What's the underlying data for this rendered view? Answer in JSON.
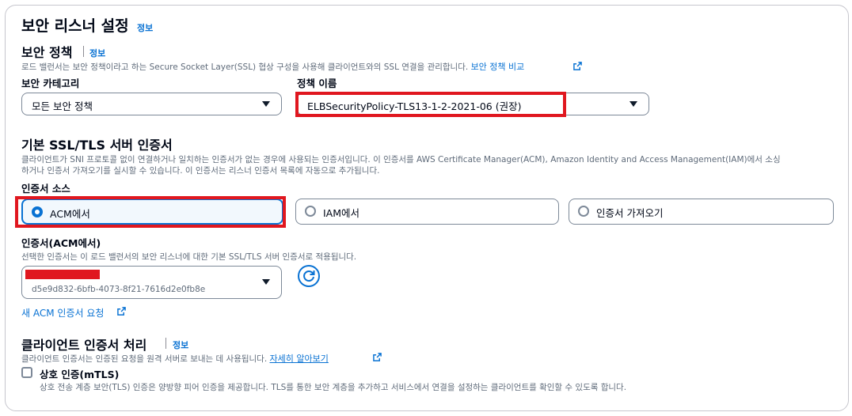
{
  "section": {
    "title": "보안 리스너 설정",
    "info": "정보"
  },
  "security_policy": {
    "title": "보안 정책",
    "info": "정보",
    "description": "로드 밸런서는 보안 정책이라고 하는 Secure Socket Layer(SSL) 협상 구성을 사용해 클라이언트와의 SSL 연결을 관리합니다.",
    "compare_link": "보안 정책 비교",
    "category_label": "보안 카테고리",
    "category_value": "모든 보안 정책",
    "name_label": "정책 이름",
    "name_value": "ELBSecurityPolicy-TLS13-1-2-2021-06 (권장)"
  },
  "certificate": {
    "title": "기본 SSL/TLS 서버 인증서",
    "description_line1": "클라이언트가 SNI 프로토콜 없이 연결하거나 일치하는 인증서가 없는 경우에 사용되는 인증서입니다. 이 인증서를 AWS Certificate Manager(ACM), Amazon Identity and Access Management(IAM)에서 소싱",
    "description_line2": "하거나 인증서 가져오기를 실시할 수 있습니다. 이 인증서는 리스너 인증서 목록에 자동으로 추가됩니다.",
    "source_label": "인증서 소스",
    "sources": [
      {
        "label": "ACM에서",
        "selected": true
      },
      {
        "label": "IAM에서",
        "selected": false
      },
      {
        "label": "인증서 가져오기",
        "selected": false
      }
    ],
    "acm_label": "인증서(ACM에서)",
    "acm_description": "선택한 인증서는 이 로드 밸런서의 보안 리스너에 대한 기본 SSL/TLS 서버 인증서로 적용됩니다.",
    "acm_value_id": "d5e9d832-6bfb-4073-8f21-7616d2e0fb8e",
    "request_link": "새 ACM 인증서 요청"
  },
  "client_cert": {
    "title": "클라이언트 인증서 처리",
    "info": "정보",
    "description": "클라이언트 인증서는 인증된 요청을 원격 서버로 보내는 데 사용됩니다.",
    "learn_more": "자세히 알아보기",
    "mtls_label": "상호 인증(mTLS)",
    "mtls_checked": false,
    "mtls_description": "상호 전송 계층 보안(TLS) 인증은 양방향 피어 인증을 제공합니다. TLS를 통한 보안 계층을 추가하고 서비스에서 연결을 설정하는 클라이언트를 확인할 수 있도록 합니다."
  },
  "colors": {
    "link": "#0972d3",
    "highlight": "#e0171f",
    "text": "#000716",
    "muted": "#5f6b7a"
  }
}
